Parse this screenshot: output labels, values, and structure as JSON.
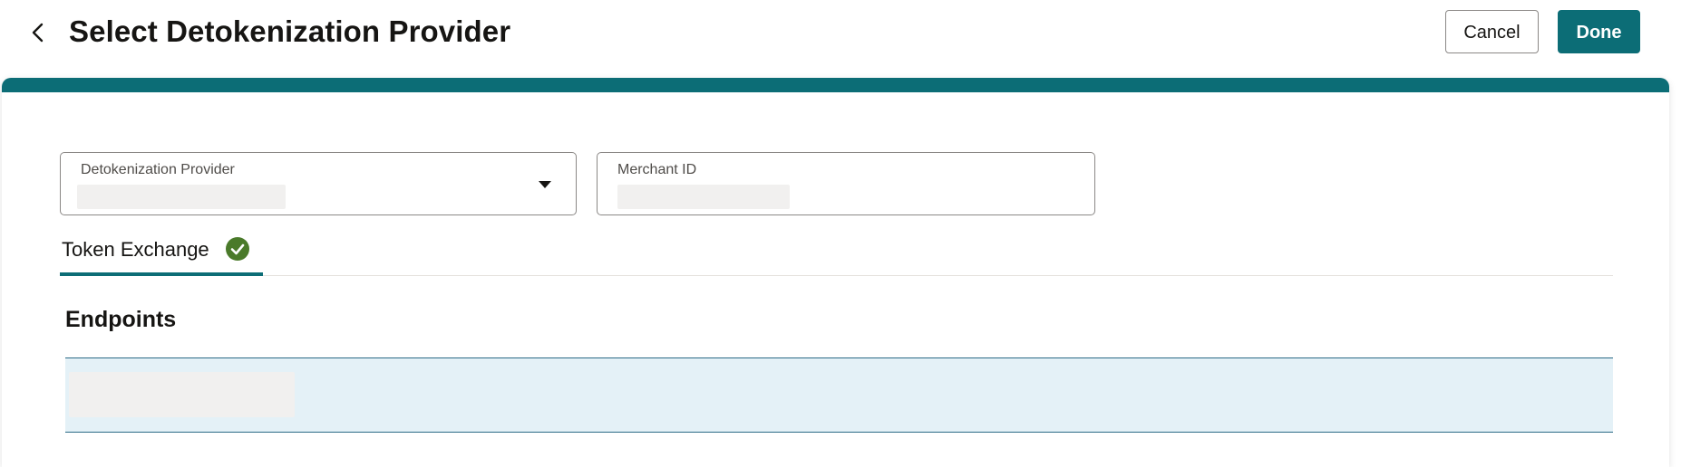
{
  "header": {
    "title": "Select Detokenization Provider",
    "back_icon": "chevron-left-icon",
    "cancel_label": "Cancel",
    "done_label": "Done"
  },
  "form": {
    "provider": {
      "label": "Detokenization Provider",
      "value": "",
      "dropdown_icon": "caret-down-icon"
    },
    "merchant": {
      "label": "Merchant ID",
      "value": ""
    }
  },
  "tabs": [
    {
      "label": "Token Exchange",
      "selected": true,
      "status_icon": "check-circle-icon",
      "status_color": "#4a7a2a"
    }
  ],
  "endpoints": {
    "title": "Endpoints",
    "rows": [
      {
        "value": ""
      }
    ]
  },
  "colors": {
    "accent": "#0c6d76",
    "selected_row_bg": "#e4f1f7",
    "selected_row_border": "#2b6a86",
    "success": "#4a7a2a"
  }
}
